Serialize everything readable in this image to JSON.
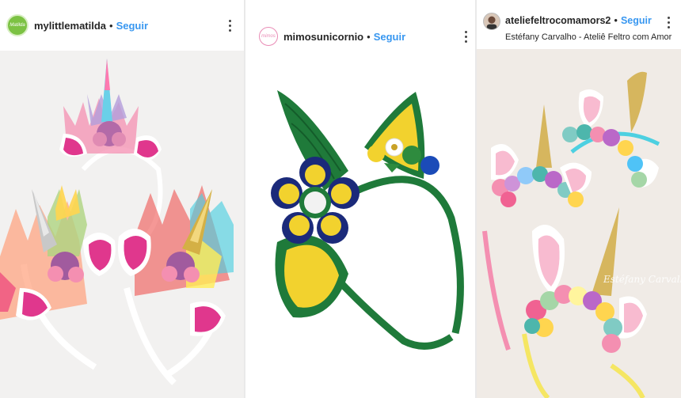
{
  "posts": [
    {
      "username": "mylittlematilda",
      "separator": "•",
      "follow_label": "Seguir",
      "avatar_text": "Matilda",
      "avatar_color": "#7cc243",
      "photo_bg": "#f2f1f0"
    },
    {
      "username": "mimosunicornio",
      "separator": "•",
      "follow_label": "Seguir",
      "avatar_text": "mimos",
      "avatar_color": "#e98bb5",
      "photo_bg": "#ffffff"
    },
    {
      "username": "ateliefeltrocomamors2",
      "separator": "•",
      "follow_label": "Seguir",
      "subtitle": "Estéfany Carvalho - Ateliê Feltro com Amor",
      "photo_bg": "#f0ebe6",
      "watermark": "Estéfany Carvalho"
    }
  ],
  "colors": {
    "link_blue": "#3897f0",
    "text_dark": "#262626"
  },
  "icons": [
    "more-options-icon",
    "avatar-logo"
  ]
}
